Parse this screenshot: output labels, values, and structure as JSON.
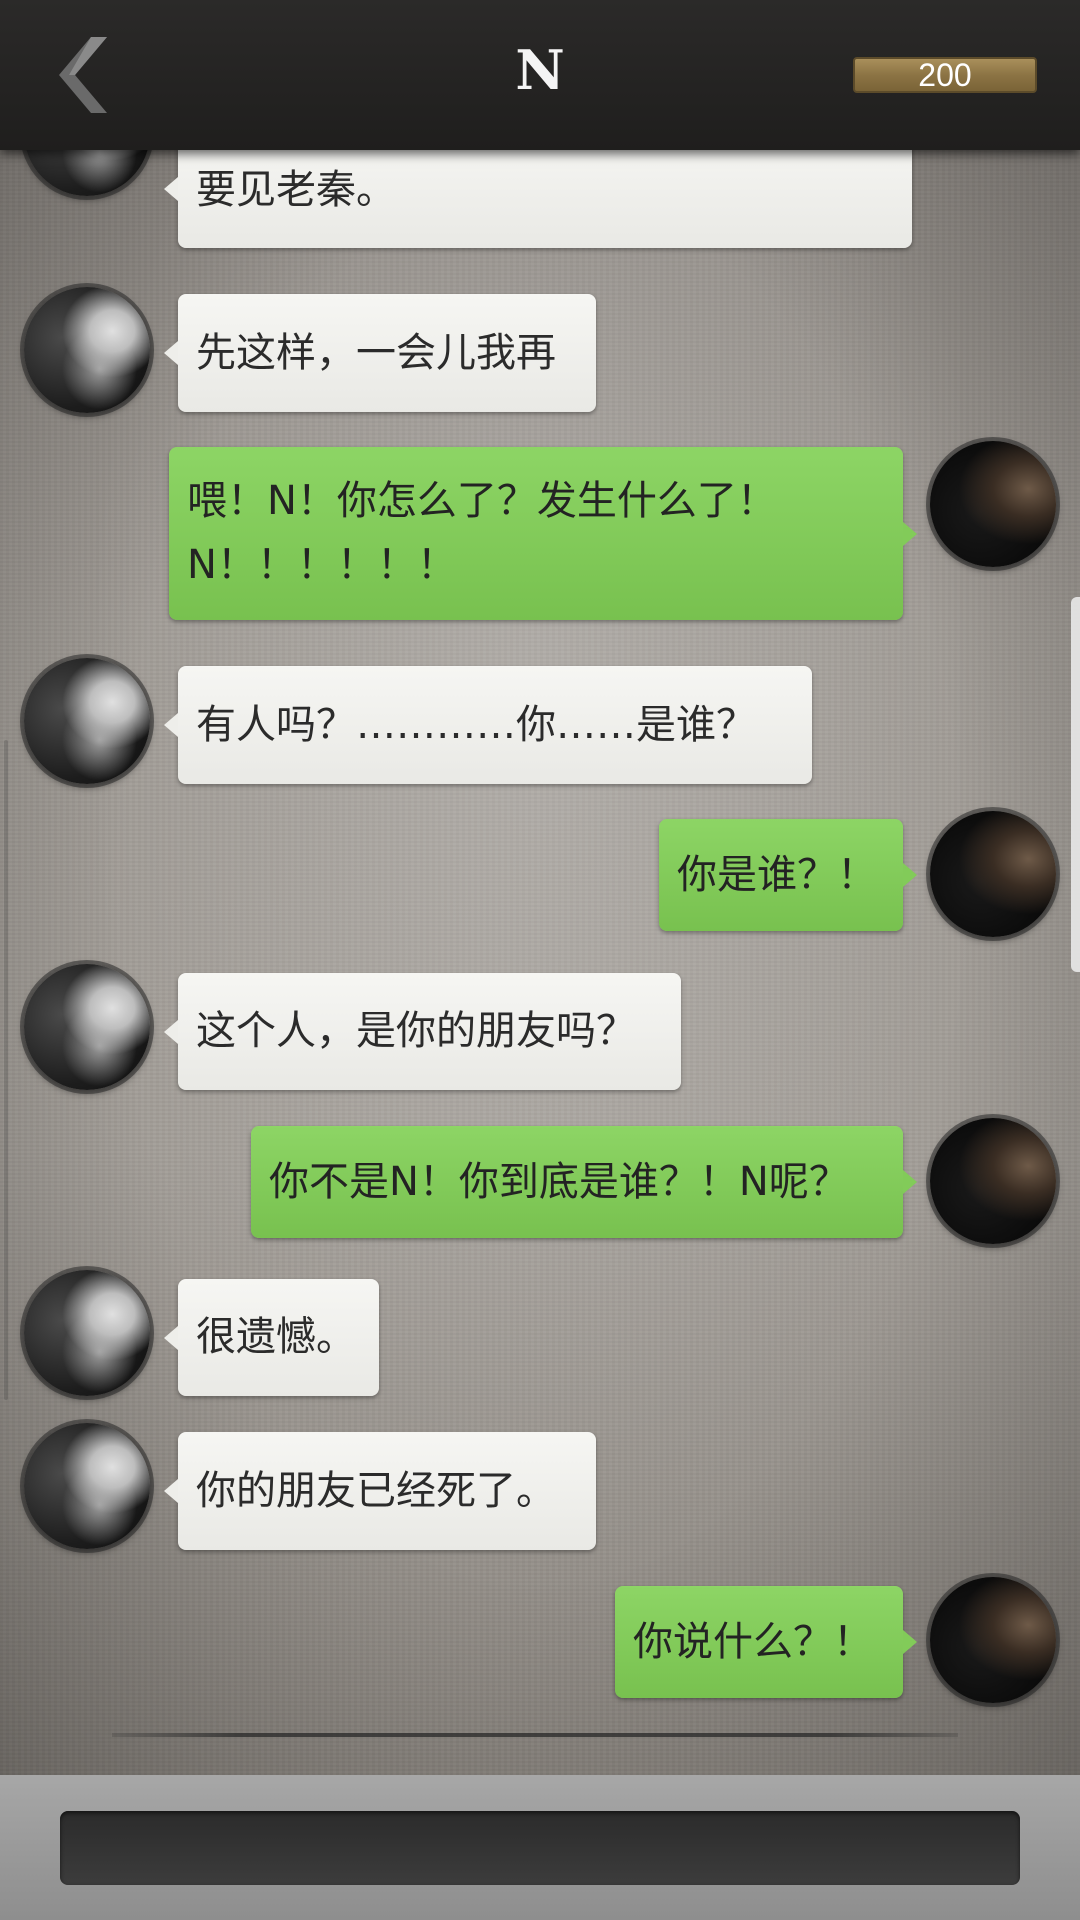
{
  "header": {
    "title": "N",
    "coins": "200",
    "back_icon": "chevron-left-icon"
  },
  "messages": [
    {
      "side": "in",
      "text": "要见老秦。"
    },
    {
      "side": "in",
      "text": "先这样，一会儿我再"
    },
    {
      "side": "out",
      "line1": "喂！N！你怎么了？发生什么了！",
      "line2": "N！！！！！！"
    },
    {
      "side": "in",
      "text": "有人吗？…………你……是谁？"
    },
    {
      "side": "out",
      "text": "你是谁？！"
    },
    {
      "side": "in",
      "text": "这个人，是你的朋友吗？"
    },
    {
      "side": "out",
      "text": "你不是N！你到底是谁？！N呢？"
    },
    {
      "side": "in",
      "text": "很遗憾。"
    },
    {
      "side": "in",
      "text": "你的朋友已经死了。"
    },
    {
      "side": "out",
      "text": "你说什么？！"
    }
  ],
  "colors": {
    "incoming_bubble": "#eeeeea",
    "outgoing_bubble": "#82cb59",
    "header": "#232221",
    "coin_bar": "#8c7444"
  }
}
